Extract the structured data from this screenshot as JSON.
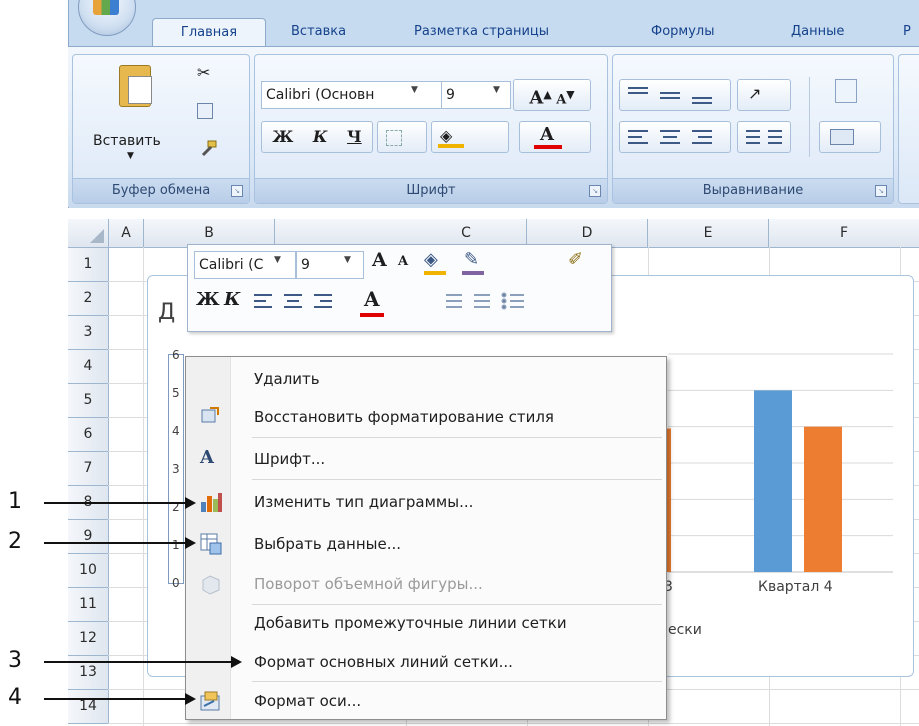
{
  "ribbon": {
    "tabs": [
      "Главная",
      "Вставка",
      "Разметка страницы",
      "Формулы",
      "Данные",
      "Р"
    ],
    "clipboard": {
      "paste_label": "Вставить",
      "group_label": "Буфер обмена"
    },
    "font": {
      "font_name": "Calibri (Основн",
      "font_size": "9",
      "bold": "Ж",
      "italic": "К",
      "underline": "Ч",
      "grow": "A",
      "shrink": "A",
      "group_label": "Шрифт",
      "font_color_glyph": "A"
    },
    "alignment": {
      "group_label": "Выравнивание"
    }
  },
  "sheet": {
    "columns": [
      "A",
      "B",
      "C",
      "D",
      "E",
      "F"
    ],
    "rows": [
      "1",
      "2",
      "3",
      "4",
      "5",
      "6",
      "7",
      "8",
      "9",
      "10",
      "11",
      "12",
      "13",
      "14"
    ]
  },
  "chart": {
    "title_fragment": "Д",
    "axis_ticks": [
      "6",
      "5",
      "4",
      "3",
      "2",
      "1",
      "0"
    ],
    "category_label": "Квартал 4",
    "axis_title_fragment": "ески",
    "category_fragment": "3",
    "colors": {
      "series1": "#5b9bd5",
      "series2": "#ed7d31"
    }
  },
  "chart_data": {
    "type": "bar",
    "categories": [
      "Квартал 4"
    ],
    "series": [
      {
        "values": [
          5.0
        ]
      },
      {
        "values": [
          4.0
        ]
      }
    ],
    "ylim": [
      0,
      6
    ]
  },
  "minitoolbar": {
    "font_name": "Calibri (С",
    "font_size": "9",
    "bold": "Ж",
    "italic": "К",
    "grow": "A",
    "shrink": "A",
    "font_color_glyph": "A"
  },
  "context_menu": {
    "items": [
      {
        "label": "Удалить",
        "icon": "none",
        "enabled": true
      },
      {
        "label": "Восстановить форматирование стиля",
        "icon": "reset-style-icon",
        "enabled": true
      },
      {
        "label": "Шрифт...",
        "icon": "font-icon",
        "enabled": true
      },
      {
        "label": "Изменить тип диаграммы...",
        "icon": "chart-type-icon",
        "enabled": true
      },
      {
        "label": "Выбрать данные...",
        "icon": "select-data-icon",
        "enabled": true
      },
      {
        "label": "Поворот объемной фигуры...",
        "icon": "rotation-3d-icon",
        "enabled": false
      },
      {
        "label": "Добавить промежуточные линии сетки",
        "icon": "none",
        "enabled": true
      },
      {
        "label": "Формат основных линий сетки...",
        "icon": "none",
        "enabled": true
      },
      {
        "label": "Формат оси...",
        "icon": "format-axis-icon",
        "enabled": true
      }
    ]
  },
  "callouts": [
    "1",
    "2",
    "3",
    "4"
  ]
}
